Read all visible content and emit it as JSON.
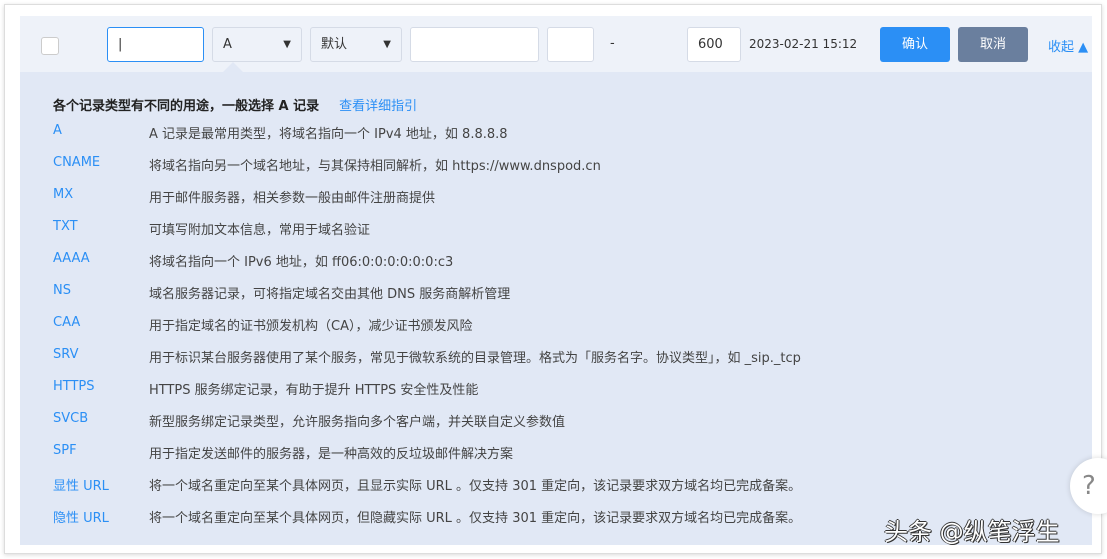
{
  "form": {
    "host_value": "|",
    "type_value": "A",
    "line_value": "默认",
    "record_value": "",
    "mx_value": "",
    "mx_separator": "-",
    "ttl_value": "600",
    "updated": "2023-02-21 15:12",
    "confirm_label": "确认",
    "cancel_label": "取消",
    "collapse_label": "收起 ▲",
    "arrow": "▼"
  },
  "help": {
    "title": "各个记录类型有不同的用途，一般选择 A 记录",
    "guide_link": "查看详细指引",
    "items": [
      {
        "type": "A",
        "desc": "A 记录是最常用类型，将域名指向一个 IPv4 地址，如 8.8.8.8"
      },
      {
        "type": "CNAME",
        "desc": "将域名指向另一个域名地址，与其保持相同解析，如 https://www.dnspod.cn"
      },
      {
        "type": "MX",
        "desc": "用于邮件服务器，相关参数一般由邮件注册商提供"
      },
      {
        "type": "TXT",
        "desc": "可填写附加文本信息，常用于域名验证"
      },
      {
        "type": "AAAA",
        "desc": "将域名指向一个 IPv6 地址，如 ff06:0:0:0:0:0:0:c3"
      },
      {
        "type": "NS",
        "desc": "域名服务器记录，可将指定域名交由其他 DNS 服务商解析管理"
      },
      {
        "type": "CAA",
        "desc": "用于指定域名的证书颁发机构（CA），减少证书颁发风险"
      },
      {
        "type": "SRV",
        "desc": "用于标识某台服务器使用了某个服务，常见于微软系统的目录管理。格式为「服务名字。协议类型」，如 _sip._tcp"
      },
      {
        "type": "HTTPS",
        "desc": "HTTPS 服务绑定记录，有助于提升 HTTPS 安全性及性能"
      },
      {
        "type": "SVCB",
        "desc": "新型服务绑定记录类型，允许服务指向多个客户端，并关联自定义参数值"
      },
      {
        "type": "SPF",
        "desc": "用于指定发送邮件的服务器，是一种高效的反垃圾邮件解决方案"
      },
      {
        "type": "显性 URL",
        "desc": "将一个域名重定向至某个具体网页，且显示实际 URL 。仅支持 301 重定向，该记录要求双方域名均已完成备案。"
      },
      {
        "type": "隐性 URL",
        "desc": "将一个域名重定向至某个具体网页，但隐藏实际 URL 。仅支持 301 重定向，该记录要求双方域名均已完成备案。"
      }
    ]
  },
  "watermark": "头条 @纵笔浮生",
  "help_button": "?"
}
